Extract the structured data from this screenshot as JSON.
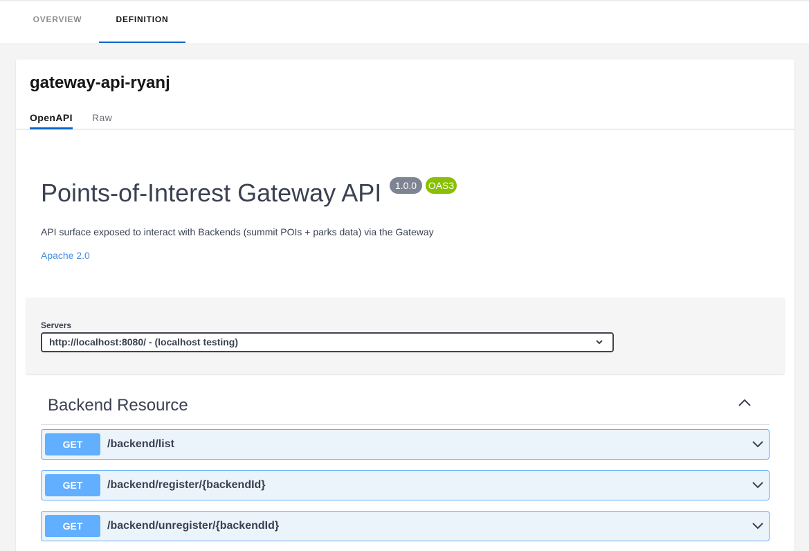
{
  "top_tabs": [
    {
      "label": "OVERVIEW",
      "active": false
    },
    {
      "label": "DEFINITION",
      "active": true
    }
  ],
  "card": {
    "title": "gateway-api-ryanj",
    "subtabs": [
      {
        "label": "OpenAPI",
        "active": true
      },
      {
        "label": "Raw",
        "active": false
      }
    ]
  },
  "api": {
    "title": "Points-of-Interest Gateway API",
    "version": "1.0.0",
    "spec": "OAS3",
    "description": "API surface exposed to interact with Backends (summit POIs + parks data) via the Gateway",
    "license": "Apache 2.0"
  },
  "servers": {
    "label": "Servers",
    "selected": "http://localhost:8080/ - (localhost testing)"
  },
  "section": {
    "title": "Backend Resource",
    "operations": [
      {
        "method": "GET",
        "path": "/backend/list"
      },
      {
        "method": "GET",
        "path": "/backend/register/{backendId}"
      },
      {
        "method": "GET",
        "path": "/backend/unregister/{backendId}"
      }
    ]
  },
  "colors": {
    "tab_underline": "#0066cc",
    "get_method": "#61affe",
    "get_row_bg": "#ebf3fb",
    "version_badge": "#7d8492",
    "oas_badge": "#89bf04",
    "link": "#4990e2"
  },
  "icons": {
    "select": "chevron-down-icon",
    "collapse": "chevron-up-icon",
    "operation": "chevron-down-icon"
  }
}
